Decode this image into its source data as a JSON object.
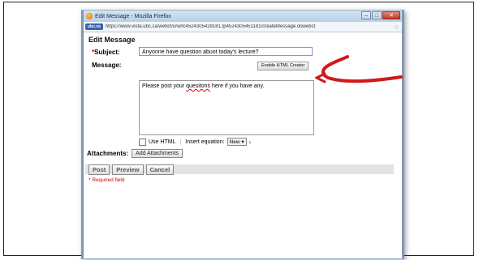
{
  "window": {
    "title": "Edit Message - Mozilla Firefox",
    "site_badge": "ubc.ca",
    "url": "https://www.vista.ubc.ca/webct/urw/lc4524305428181.tp4524305451181/createMessage.dowebct",
    "minimize": "–",
    "maximize": "□",
    "close": "✕"
  },
  "page": {
    "heading": "Edit Message",
    "subject_required_mark": "*",
    "subject_label": "Subject:",
    "subject_value": "Anyonne have question abuot today's lecture?",
    "message_label": "Message:",
    "enable_html_creator": "Enable HTML Creator",
    "message_prefix": "Please post your ",
    "message_misspelled": "quesitons",
    "message_suffix": " here if you have any.",
    "use_html_label": "Use HTML",
    "insert_equation_label": "Insert equation:",
    "equation_option": "New",
    "attachments_label": "Attachments:",
    "add_attachments": "Add Attachments",
    "post": "Post",
    "preview": "Preview",
    "cancel": "Cancel",
    "required_note": "* Required field"
  },
  "colors": {
    "annotation_arrow": "#d01818",
    "required": "#cc0000"
  }
}
